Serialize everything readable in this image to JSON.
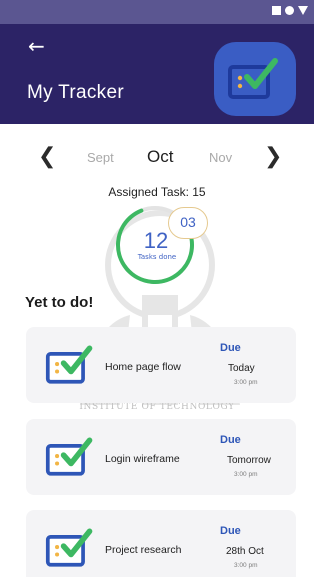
{
  "status_bar": {
    "icons": [
      "square-icon",
      "circle-icon",
      "triangle-icon"
    ]
  },
  "header": {
    "back_icon": "arrow-left-icon",
    "title": "My Tracker",
    "badge_icon": "task-check-icon",
    "color": "#2c2366",
    "badge_color": "#3a5dc4"
  },
  "month_selector": {
    "prev_icon": "chevron-left-icon",
    "next_icon": "chevron-right-icon",
    "previous": "Sept",
    "current": "Oct",
    "next": "Nov"
  },
  "progress": {
    "assigned_label": "Assigned Task: 15",
    "assigned_total": 15,
    "done_count": "12",
    "done_label": "Tasks done",
    "done_fraction": 0.8,
    "remaining": "03",
    "ring_color": "#3db862"
  },
  "watermark_text": "INSTITUTE OF TECHNOLOGY",
  "section_title": "Yet to do!",
  "tasks": [
    {
      "name": "Home page flow",
      "due_label": "Due",
      "when": "Today",
      "time": "3:00 pm",
      "icon": "task-check-icon"
    },
    {
      "name": "Login wireframe",
      "due_label": "Due",
      "when": "Tomorrow",
      "time": "3:00 pm",
      "icon": "task-check-icon"
    },
    {
      "name": "Project research",
      "due_label": "Due",
      "when": "28th Oct",
      "time": "3:00 pm",
      "icon": "task-check-icon"
    }
  ],
  "colors": {
    "accent_blue": "#2e56b7",
    "check_green": "#3db862",
    "status_bar": "#5b5691"
  }
}
